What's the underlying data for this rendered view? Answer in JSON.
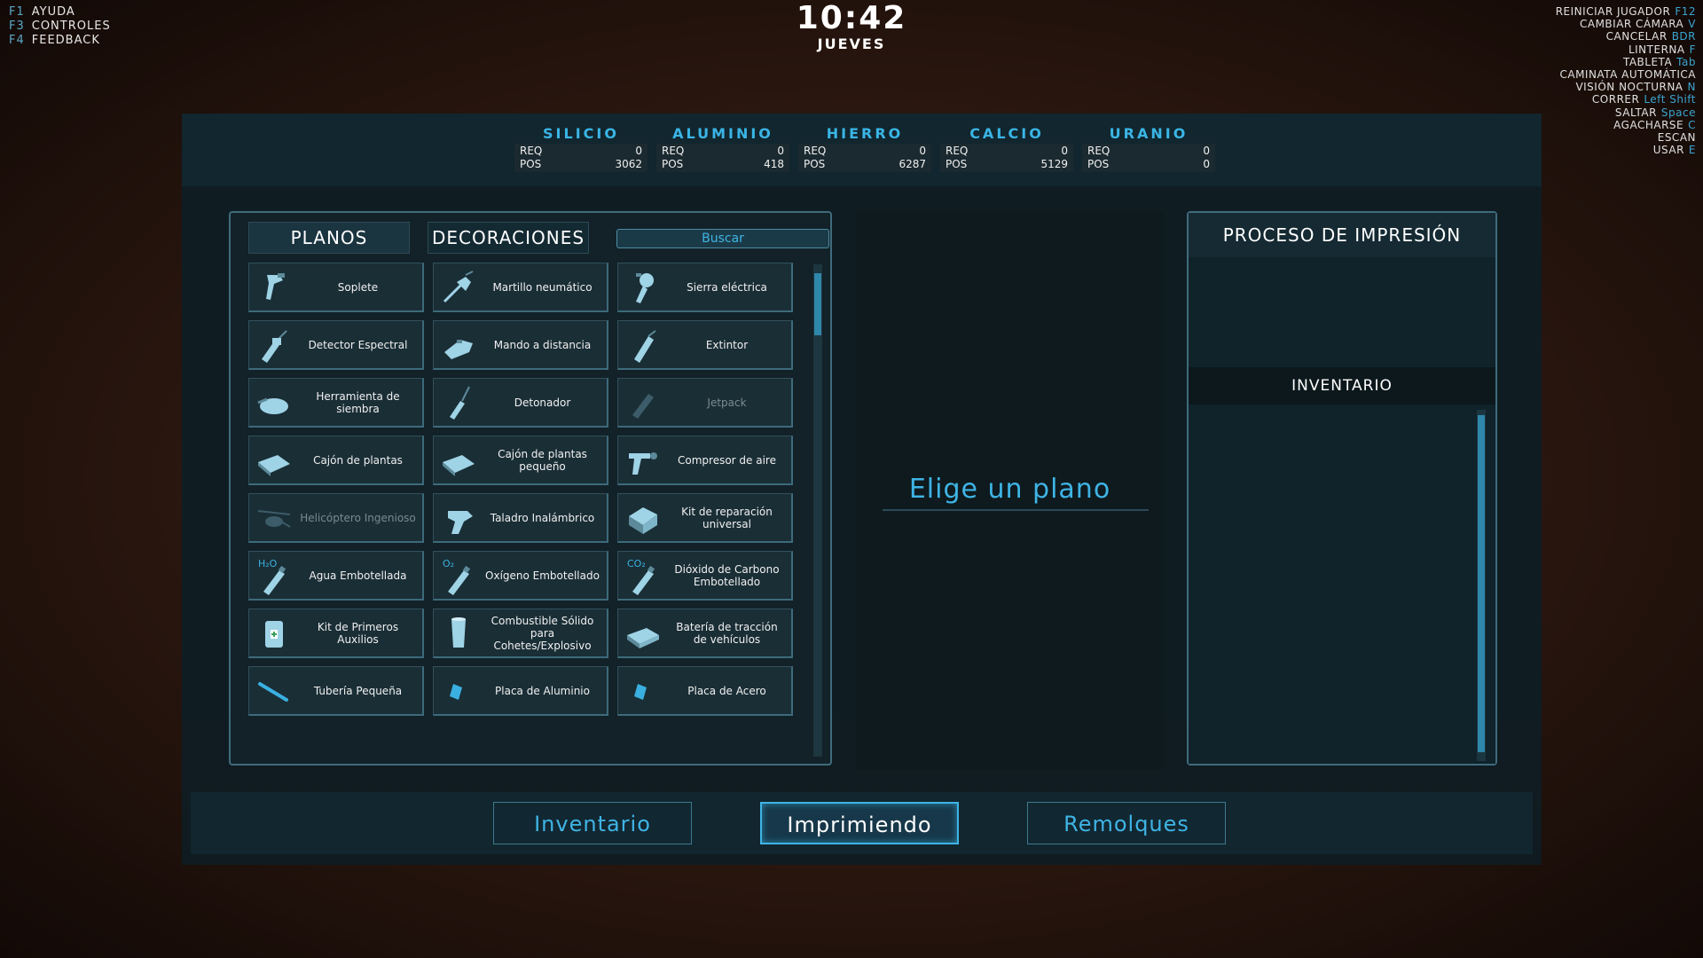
{
  "help": [
    {
      "key": "F1",
      "label": "AYUDA"
    },
    {
      "key": "F3",
      "label": "CONTROLES"
    },
    {
      "key": "F4",
      "label": "FEEDBACK"
    }
  ],
  "clock": {
    "time": "10:42",
    "day": "JUEVES"
  },
  "controls": [
    {
      "label": "REINICIAR JUGADOR",
      "key": "F12"
    },
    {
      "label": "CAMBIAR CÁMARA",
      "key": "V"
    },
    {
      "label": "CANCELAR",
      "key": "BDR"
    },
    {
      "label": "LINTERNA",
      "key": "F"
    },
    {
      "label": "TABLETA",
      "key": "Tab"
    },
    {
      "label": "CAMINATA AUTOMÁTICA",
      "key": ""
    },
    {
      "label": "VISIÓN NOCTURNA",
      "key": "N"
    },
    {
      "label": "CORRER",
      "key": "Left Shift"
    },
    {
      "label": "SALTAR",
      "key": "Space"
    },
    {
      "label": "AGACHARSE",
      "key": "C"
    },
    {
      "label": "ESCAN",
      "key": ""
    },
    {
      "label": "USAR",
      "key": "E"
    }
  ],
  "resources": [
    {
      "name": "SILICIO",
      "req_label": "REQ",
      "req": "0",
      "pos_label": "POS",
      "pos": "3062"
    },
    {
      "name": "ALUMINIO",
      "req_label": "REQ",
      "req": "0",
      "pos_label": "POS",
      "pos": "418"
    },
    {
      "name": "HIERRO",
      "req_label": "REQ",
      "req": "0",
      "pos_label": "POS",
      "pos": "6287"
    },
    {
      "name": "CALCIO",
      "req_label": "REQ",
      "req": "0",
      "pos_label": "POS",
      "pos": "5129"
    },
    {
      "name": "URANIO",
      "req_label": "REQ",
      "req": "0",
      "pos_label": "POS",
      "pos": "0"
    }
  ],
  "tabs": {
    "planos": "PLANOS",
    "decoraciones": "DECORACIONES"
  },
  "search": {
    "placeholder": "Buscar"
  },
  "items": [
    {
      "label": "Soplete",
      "icon": "blowtorch-icon",
      "enabled": true
    },
    {
      "label": "Martillo neumático",
      "icon": "jackhammer-icon",
      "enabled": true
    },
    {
      "label": "Sierra eléctrica",
      "icon": "saw-icon",
      "enabled": true
    },
    {
      "label": "Detector Espectral",
      "icon": "detector-icon",
      "enabled": true
    },
    {
      "label": "Mando a distancia",
      "icon": "remote-icon",
      "enabled": true
    },
    {
      "label": "Extintor",
      "icon": "extinguisher-icon",
      "enabled": true
    },
    {
      "label": "Herramienta de siembra",
      "icon": "seeder-icon",
      "enabled": true
    },
    {
      "label": "Detonador",
      "icon": "detonator-icon",
      "enabled": true
    },
    {
      "label": "Jetpack",
      "icon": "jetpack-icon",
      "enabled": false
    },
    {
      "label": "Cajón de plantas",
      "icon": "planter-icon",
      "enabled": true
    },
    {
      "label": "Cajón de plantas pequeño",
      "icon": "planter-icon",
      "enabled": true
    },
    {
      "label": "Compresor de aire",
      "icon": "compressor-icon",
      "enabled": true
    },
    {
      "label": "Helicóptero Ingenioso",
      "icon": "helicopter-icon",
      "enabled": false
    },
    {
      "label": "Taladro Inalámbrico",
      "icon": "drill-icon",
      "enabled": true
    },
    {
      "label": "Kit de reparación universal",
      "icon": "repair-kit-icon",
      "enabled": true
    },
    {
      "label": "Agua Embotellada",
      "icon": "bottle-icon",
      "badge": "H₂O",
      "enabled": true
    },
    {
      "label": "Oxígeno Embotellado",
      "icon": "bottle-icon",
      "badge": "O₂",
      "enabled": true
    },
    {
      "label": "Dióxido de Carbono Embotellado",
      "icon": "bottle-icon",
      "badge": "CO₂",
      "enabled": true
    },
    {
      "label": "Kit de Primeros Auxilios",
      "icon": "first-aid-icon",
      "enabled": true
    },
    {
      "label": "Combustible Sólido para Cohetes/Explosivo",
      "icon": "fuel-icon",
      "enabled": true
    },
    {
      "label": "Batería de tracción de vehículos",
      "icon": "battery-icon",
      "enabled": true
    },
    {
      "label": "Tubería Pequeña",
      "icon": "pipe-icon",
      "enabled": true
    },
    {
      "label": "Placa de Aluminio",
      "icon": "plate-icon",
      "enabled": true
    },
    {
      "label": "Placa de Acero",
      "icon": "plate-icon",
      "enabled": true
    }
  ],
  "center": {
    "message": "Elige un plano"
  },
  "right": {
    "title": "PROCESO DE IMPRESIÓN",
    "inventory_title": "INVENTARIO"
  },
  "bottom": {
    "inventario": "Inventario",
    "imprimiendo": "Imprimiendo",
    "remolques": "Remolques"
  },
  "colors": {
    "accent": "#3fb4e5",
    "panel": "#122228"
  }
}
